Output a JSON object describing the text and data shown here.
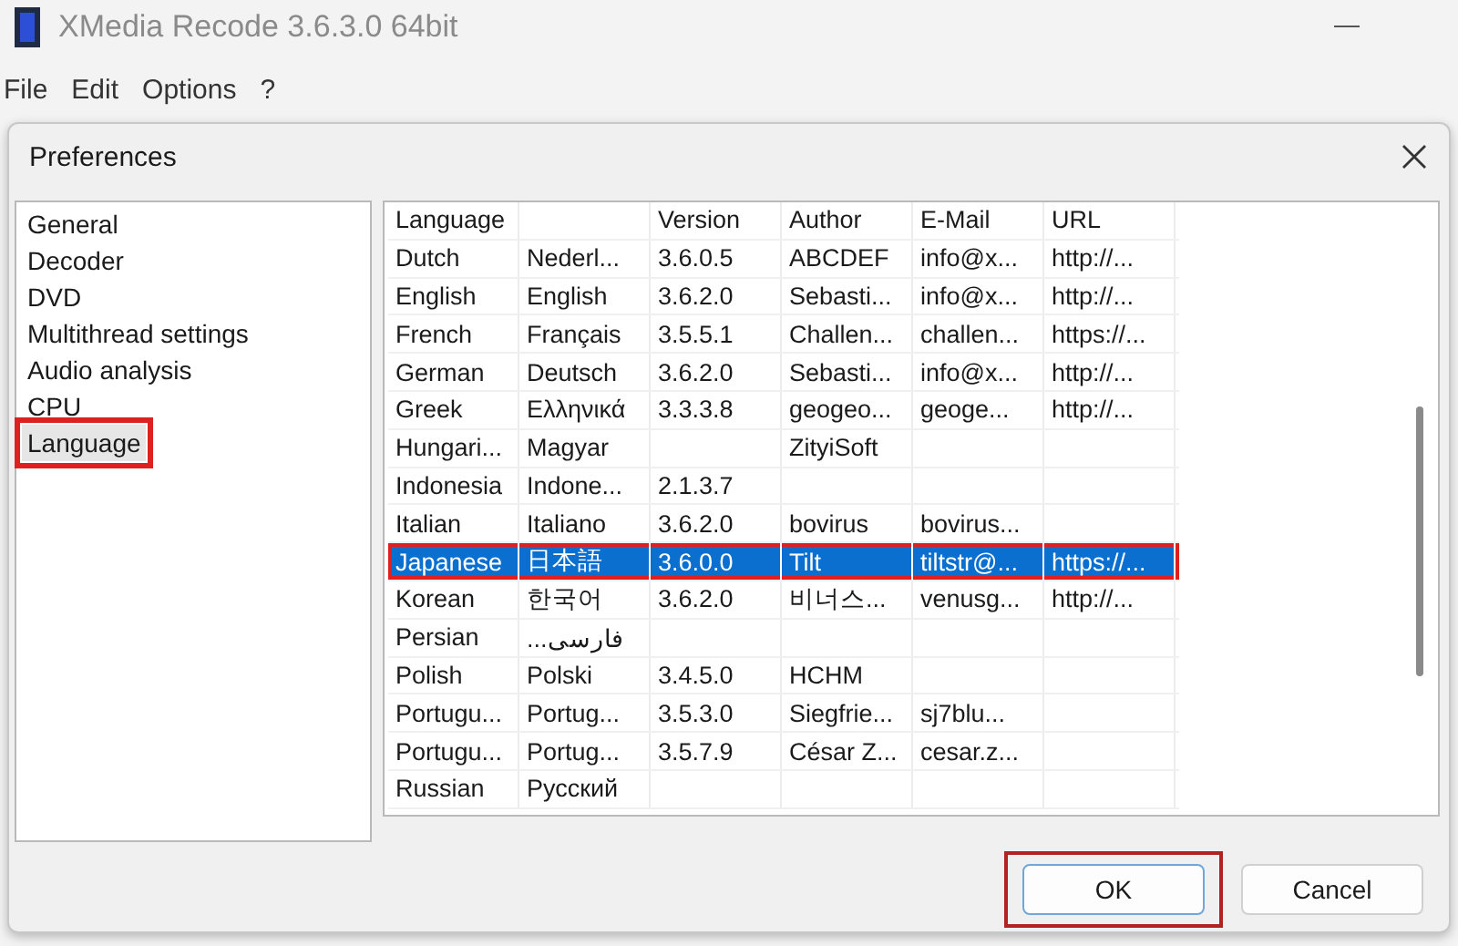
{
  "window": {
    "title": "XMedia Recode 3.6.3.0 64bit"
  },
  "menu": [
    "File",
    "Edit",
    "Options",
    "?"
  ],
  "dialog": {
    "title": "Preferences",
    "sidebar": {
      "items": [
        {
          "label": "General",
          "selected": false,
          "highlighted": false
        },
        {
          "label": "Decoder",
          "selected": false,
          "highlighted": false
        },
        {
          "label": "DVD",
          "selected": false,
          "highlighted": false
        },
        {
          "label": "Multithread settings",
          "selected": false,
          "highlighted": false
        },
        {
          "label": "Audio analysis",
          "selected": false,
          "highlighted": false
        },
        {
          "label": "CPU",
          "selected": false,
          "highlighted": false
        },
        {
          "label": "Language",
          "selected": true,
          "highlighted": true
        }
      ]
    },
    "table": {
      "columns": [
        "Language",
        null,
        "Version",
        "Author",
        "E-Mail",
        "URL"
      ],
      "rows": [
        {
          "cells": [
            "Dutch",
            "Nederl...",
            "3.6.0.5",
            "ABCDEF",
            "info@x...",
            "http://..."
          ],
          "selected": false,
          "highlighted": false
        },
        {
          "cells": [
            "English",
            "English",
            "3.6.2.0",
            "Sebasti...",
            "info@x...",
            "http://..."
          ],
          "selected": false,
          "highlighted": false
        },
        {
          "cells": [
            "French",
            "Français",
            "3.5.5.1",
            "Challen...",
            "challen...",
            "https://..."
          ],
          "selected": false,
          "highlighted": false
        },
        {
          "cells": [
            "German",
            "Deutsch",
            "3.6.2.0",
            "Sebasti...",
            "info@x...",
            "http://..."
          ],
          "selected": false,
          "highlighted": false
        },
        {
          "cells": [
            "Greek",
            "Ελληνικά",
            "3.3.3.8",
            "geogeo...",
            "geoge...",
            "http://..."
          ],
          "selected": false,
          "highlighted": false
        },
        {
          "cells": [
            "Hungari...",
            "Magyar",
            null,
            "ZityiSoft",
            null,
            null
          ],
          "selected": false,
          "highlighted": false
        },
        {
          "cells": [
            "Indonesia",
            "Indone...",
            "2.1.3.7",
            null,
            null,
            null
          ],
          "selected": false,
          "highlighted": false
        },
        {
          "cells": [
            "Italian",
            "Italiano",
            "3.6.2.0",
            "bovirus",
            "bovirus...",
            null
          ],
          "selected": false,
          "highlighted": false
        },
        {
          "cells": [
            "Japanese",
            "日本語",
            "3.6.0.0",
            "Tilt",
            "tiltstr@...",
            "https://..."
          ],
          "selected": true,
          "highlighted": true
        },
        {
          "cells": [
            "Korean",
            "한국어",
            "3.6.2.0",
            "비너스...",
            "venusg...",
            "http://..."
          ],
          "selected": false,
          "highlighted": false
        },
        {
          "cells": [
            "Persian",
            "فارسی...",
            null,
            null,
            null,
            null
          ],
          "selected": false,
          "highlighted": false
        },
        {
          "cells": [
            "Polish",
            "Polski",
            "3.4.5.0",
            "HCHM",
            null,
            null
          ],
          "selected": false,
          "highlighted": false
        },
        {
          "cells": [
            "Portugu...",
            "Portug...",
            "3.5.3.0",
            "Siegfrie...",
            "sj7blu...",
            null
          ],
          "selected": false,
          "highlighted": false
        },
        {
          "cells": [
            "Portugu...",
            "Portug...",
            "3.5.7.9",
            "César Z...",
            "cesar.z...",
            null
          ],
          "selected": false,
          "highlighted": false
        },
        {
          "cells": [
            "Russian",
            "Русский",
            null,
            null,
            null,
            null
          ],
          "selected": false,
          "highlighted": false
        }
      ]
    },
    "buttons": [
      {
        "label": "OK",
        "default": true,
        "highlighted": true
      },
      {
        "label": "Cancel",
        "default": false,
        "highlighted": false
      }
    ]
  }
}
